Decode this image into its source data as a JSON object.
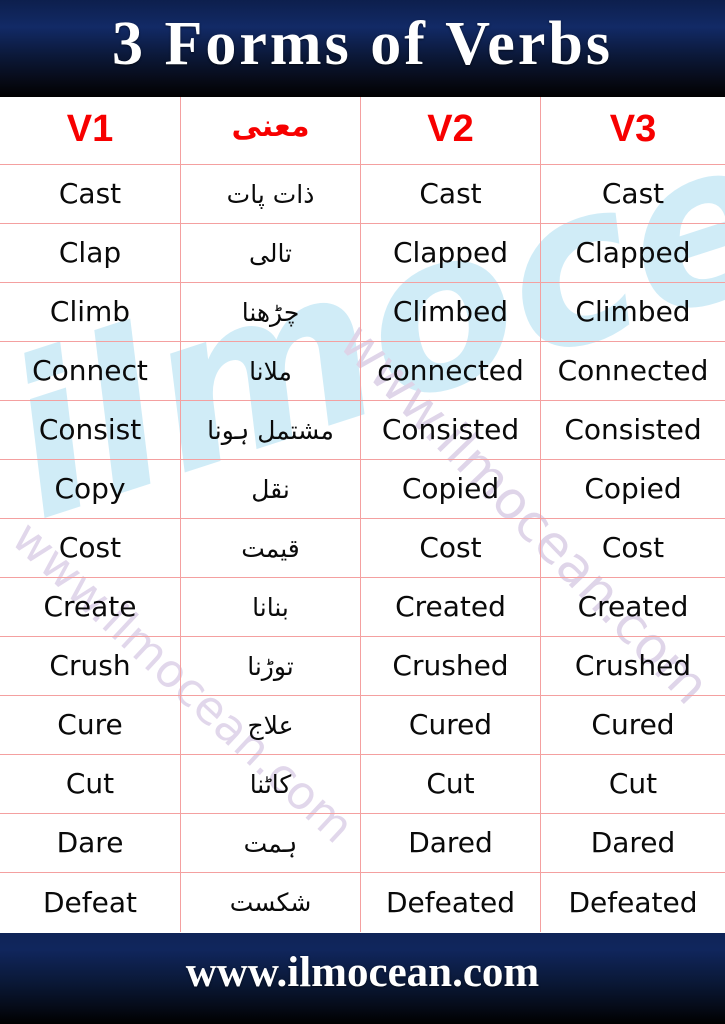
{
  "banner": {
    "title": "3 Forms of Verbs",
    "background_color": "#0d1f4d",
    "text_color": "#ffffff"
  },
  "watermark": {
    "logo_text": "ilmocean",
    "logo_color": "#bfe6f5",
    "url_text_1": "www.ilmocean.com",
    "url_text_2": "www.ilmocean.com",
    "url_color": "#ded3e8"
  },
  "table": {
    "header_color": "#f70000",
    "grid_color": "#f4a0a0",
    "columns": [
      {
        "key": "v1",
        "label": "V1"
      },
      {
        "key": "urdu",
        "label": "معنی"
      },
      {
        "key": "v2",
        "label": "V2"
      },
      {
        "key": "v3",
        "label": "V3"
      }
    ],
    "rows": [
      {
        "v1": "Cast",
        "urdu": "ذات پات",
        "v2": "Cast",
        "v3": "Cast"
      },
      {
        "v1": "Clap",
        "urdu": "تالی",
        "v2": "Clapped",
        "v3": "Clapped"
      },
      {
        "v1": "Climb",
        "urdu": "چڑھنا",
        "v2": "Climbed",
        "v3": "Climbed"
      },
      {
        "v1": "Connect",
        "urdu": "ملانا",
        "v2": "connected",
        "v3": "Connected"
      },
      {
        "v1": "Consist",
        "urdu": "مشتمل ہونا",
        "v2": "Consisted",
        "v3": "Consisted"
      },
      {
        "v1": "Copy",
        "urdu": "نقل",
        "v2": "Copied",
        "v3": "Copied"
      },
      {
        "v1": "Cost",
        "urdu": "قیمت",
        "v2": "Cost",
        "v3": "Cost"
      },
      {
        "v1": "Create",
        "urdu": "بنانا",
        "v2": "Created",
        "v3": "Created"
      },
      {
        "v1": "Crush",
        "urdu": "توڑنا",
        "v2": "Crushed",
        "v3": "Crushed"
      },
      {
        "v1": "Cure",
        "urdu": "علاج",
        "v2": "Cured",
        "v3": "Cured"
      },
      {
        "v1": "Cut",
        "urdu": "کاٹنا",
        "v2": "Cut",
        "v3": "Cut"
      },
      {
        "v1": "Dare",
        "urdu": "ہمت",
        "v2": "Dared",
        "v3": "Dared"
      },
      {
        "v1": "Defeat",
        "urdu": "شکست",
        "v2": "Defeated",
        "v3": "Defeated"
      }
    ]
  },
  "footer": {
    "text": "www.ilmocean.com",
    "background_color": "#0f2457",
    "text_color": "#ffffff"
  }
}
